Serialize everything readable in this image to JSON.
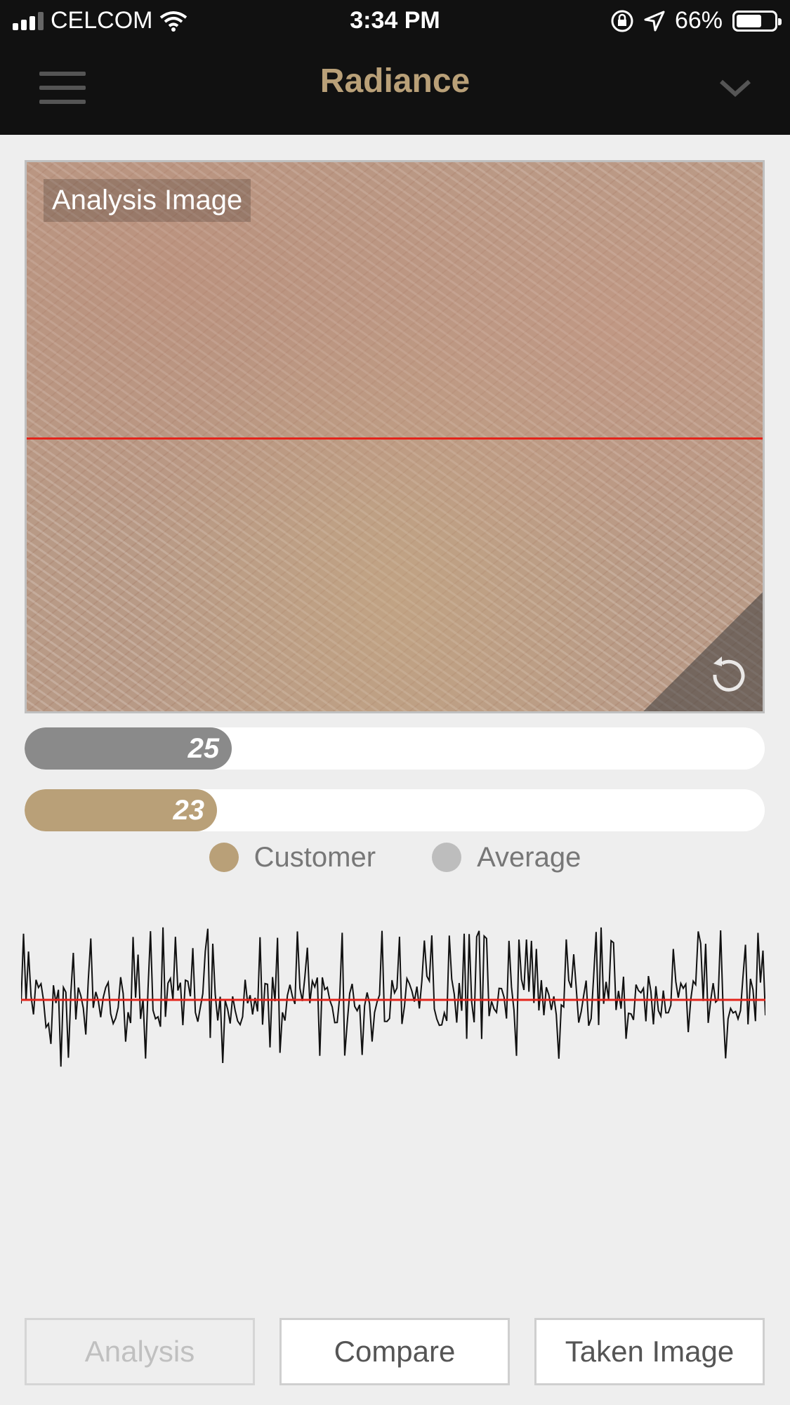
{
  "status_bar": {
    "carrier": "CELCOM",
    "time": "3:34 PM",
    "battery": "66%"
  },
  "nav": {
    "title": "Radiance"
  },
  "analysis_image": {
    "label": "Analysis Image"
  },
  "bars": [
    {
      "value": "25",
      "fraction": 0.28,
      "color": "#8a8a8a"
    },
    {
      "value": "23",
      "fraction": 0.26,
      "color": "#b9a078"
    }
  ],
  "legend": {
    "customer": {
      "label": "Customer",
      "color": "#b9a078"
    },
    "average": {
      "label": "Average",
      "color": "#bdbdbd"
    }
  },
  "buttons": {
    "analysis": "Analysis",
    "compare": "Compare",
    "taken_image": "Taken Image"
  },
  "colors": {
    "accent": "#b9a078",
    "scan_line": "#e4241b"
  }
}
